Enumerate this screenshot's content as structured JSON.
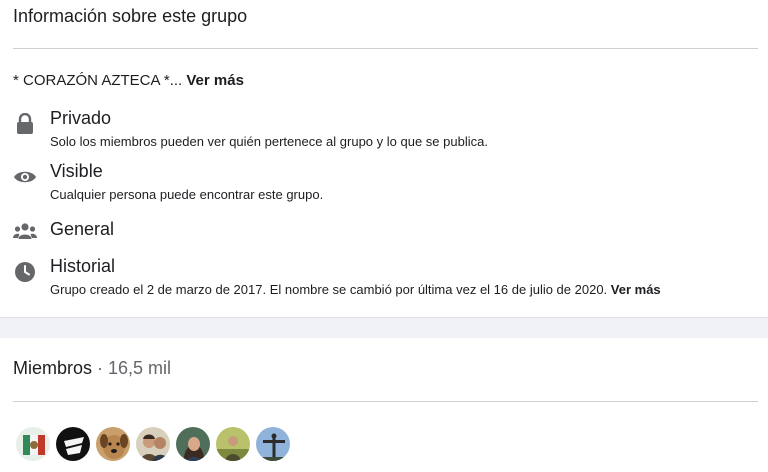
{
  "about": {
    "title": "Información sobre este grupo",
    "description": "* CORAZÓN AZTECA *... ",
    "description_more": "Ver más",
    "items": [
      {
        "icon": "lock-icon",
        "title": "Privado",
        "subtitle": "Solo los miembros pueden ver quién pertenece al grupo y lo que se publica."
      },
      {
        "icon": "eye-icon",
        "title": "Visible",
        "subtitle": "Cualquier persona puede encontrar este grupo."
      },
      {
        "icon": "people-icon",
        "title": "General",
        "subtitle": ""
      },
      {
        "icon": "clock-icon",
        "title": "Historial",
        "subtitle": "Grupo creado el 2 de marzo de 2017. El nombre se cambió por última vez el 16 de julio de 2020. ",
        "subtitle_more": "Ver más"
      }
    ]
  },
  "members": {
    "title": "Miembros",
    "separator": " · ",
    "count": "16,5 mil",
    "avatars": [
      {
        "name": "avatar-flag-crest",
        "bg": "#e8efe9",
        "fg": "#c0392b"
      },
      {
        "name": "avatar-black-logo",
        "bg": "#111111",
        "fg": "#f5f5f5"
      },
      {
        "name": "avatar-dog",
        "bg": "#b8864e",
        "fg": "#6b4423"
      },
      {
        "name": "avatar-couple",
        "bg": "#c9b79a",
        "fg": "#5a4632"
      },
      {
        "name": "avatar-woman",
        "bg": "#4f6f5a",
        "fg": "#3a2a22"
      },
      {
        "name": "avatar-outdoor",
        "bg": "#a8b455",
        "fg": "#4b4b2f"
      },
      {
        "name": "avatar-statue",
        "bg": "#7ea3cf",
        "fg": "#2b2b2b"
      }
    ]
  },
  "colors": {
    "icon_gray": "#65676b",
    "divider": "#ced0d4",
    "background": "#f0f2f5"
  }
}
